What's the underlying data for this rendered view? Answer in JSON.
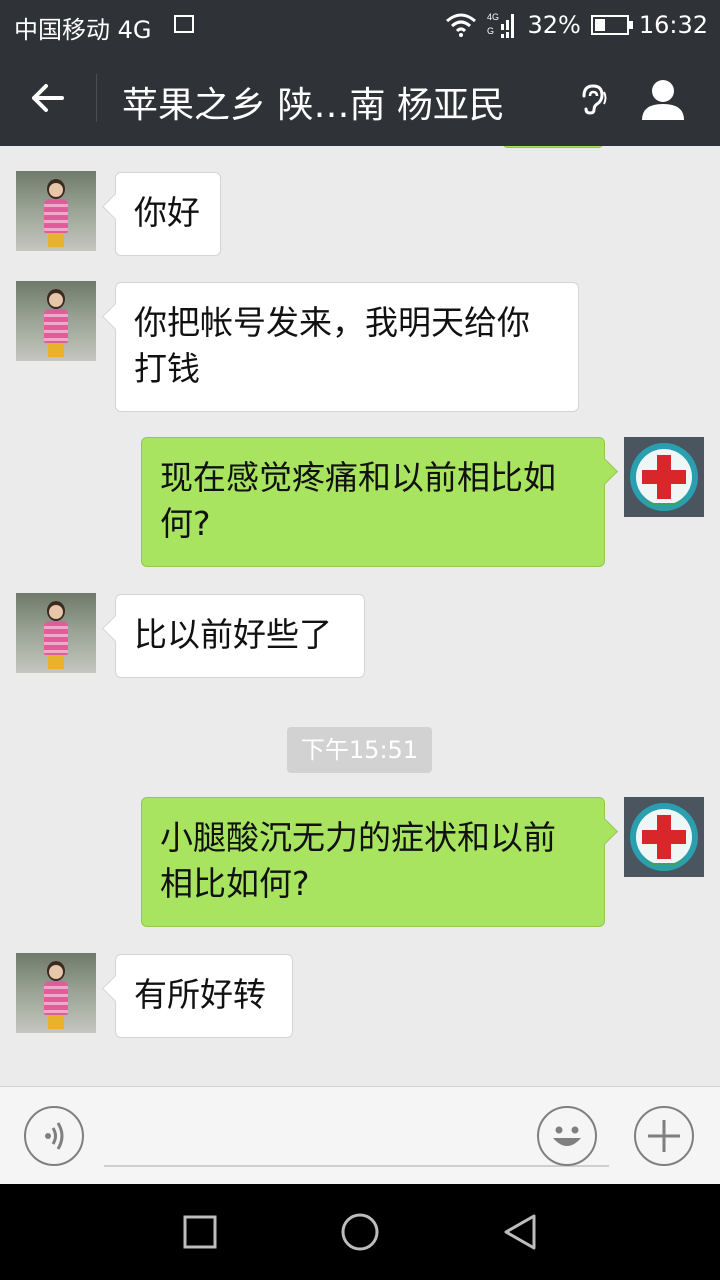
{
  "status_bar": {
    "carrier": "中国移动 4G",
    "battery": "32%",
    "time": "16:32"
  },
  "header": {
    "title": "苹果之乡 陕…南 杨亚民",
    "back_icon": "back-arrow-icon",
    "earpiece_icon": "ear-icon",
    "profile_icon": "profile-icon"
  },
  "messages": [
    {
      "side": "in",
      "text": "你好"
    },
    {
      "side": "in",
      "text": "你把帐号发来，我明天给你打钱"
    },
    {
      "side": "out",
      "text": "现在感觉疼痛和以前相比如何?"
    },
    {
      "side": "in",
      "text": "比以前好些了"
    },
    {
      "side": "time",
      "text": "下午15:51"
    },
    {
      "side": "out",
      "text": "小腿酸沉无力的症状和以前相比如何?"
    },
    {
      "side": "in",
      "text": "有所好转"
    }
  ],
  "input_bar": {
    "voice_icon": "voice-icon",
    "input_value": "",
    "emoji_icon": "emoji-icon",
    "more_icon": "plus-icon"
  },
  "nav_bar": {
    "recent_icon": "square-icon",
    "home_icon": "circle-icon",
    "back_icon": "triangle-back-icon"
  },
  "colors": {
    "bar_bg": "#2f3236",
    "chat_bg": "#ebebeb",
    "out_bubble": "#a8e45f",
    "in_bubble": "#ffffff"
  }
}
